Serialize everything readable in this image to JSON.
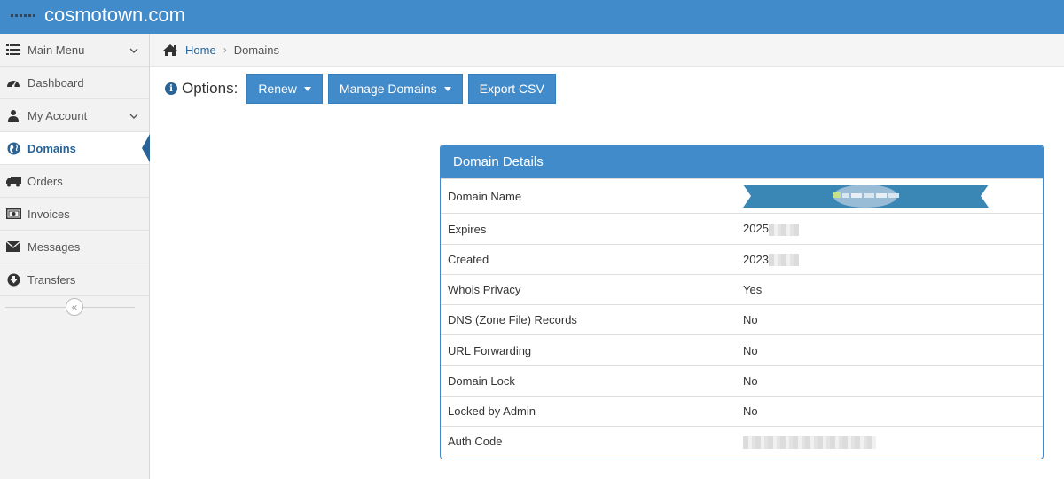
{
  "app": {
    "title": "cosmotown.com"
  },
  "sidebar": {
    "items": [
      {
        "label": "Main Menu",
        "icon": "list-icon",
        "has_chevron": true
      },
      {
        "label": "Dashboard",
        "icon": "dashboard-icon",
        "has_chevron": false
      },
      {
        "label": "My Account",
        "icon": "user-icon",
        "has_chevron": true
      },
      {
        "label": "Domains",
        "icon": "globe-icon",
        "has_chevron": false,
        "active": true
      },
      {
        "label": "Orders",
        "icon": "truck-icon",
        "has_chevron": false
      },
      {
        "label": "Invoices",
        "icon": "money-icon",
        "has_chevron": false
      },
      {
        "label": "Messages",
        "icon": "envelope-icon",
        "has_chevron": false
      },
      {
        "label": "Transfers",
        "icon": "arrow-down-circle-icon",
        "has_chevron": false
      }
    ],
    "collapse_glyph": "«"
  },
  "breadcrumb": {
    "home": "Home",
    "separator": "›",
    "current": "Domains"
  },
  "options": {
    "label": "Options:",
    "renew": "Renew",
    "manage_domains": "Manage Domains",
    "export_csv": "Export CSV"
  },
  "panel": {
    "title": "Domain Details",
    "rows": [
      {
        "key": "Domain Name",
        "value": ""
      },
      {
        "key": "Expires",
        "value": "2025"
      },
      {
        "key": "Created",
        "value": "2023"
      },
      {
        "key": "Whois Privacy",
        "value": "Yes"
      },
      {
        "key": "DNS (Zone File) Records",
        "value": "No"
      },
      {
        "key": "URL Forwarding",
        "value": "No"
      },
      {
        "key": "Domain Lock",
        "value": "No"
      },
      {
        "key": "Locked by Admin",
        "value": "No"
      },
      {
        "key": "Auth Code",
        "value": ""
      }
    ]
  },
  "colors": {
    "brand": "#428bca",
    "active": "#2a6496",
    "ribbon": "#3a86b5"
  }
}
